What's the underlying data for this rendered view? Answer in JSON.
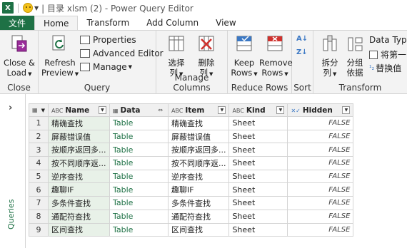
{
  "titlebar": {
    "app_letter": "X",
    "title": "| 目录 xlsm (2) - Power Query Editor"
  },
  "tabs": [
    {
      "label": "文件"
    },
    {
      "label": "Home"
    },
    {
      "label": "Transform"
    },
    {
      "label": "Add Column"
    },
    {
      "label": "View"
    }
  ],
  "ribbon": {
    "close": {
      "btn": "Close &",
      "btn2": "Load",
      "label": "Close"
    },
    "query": {
      "refresh": "Refresh",
      "refresh2": "Preview",
      "properties": "Properties",
      "advanced": "Advanced Editor",
      "manage": "Manage",
      "label": "Query"
    },
    "manage_cols": {
      "choose": "选择",
      "choose2": "列",
      "remove": "删除",
      "remove2": "列",
      "label": "Manage Columns"
    },
    "reduce": {
      "keep": "Keep",
      "keep2": "Rows",
      "remove": "Remove",
      "remove2": "Rows",
      "label": "Reduce Rows"
    },
    "sort": {
      "az": "A↓",
      "za": "Z↓",
      "label": "Sort"
    },
    "transform": {
      "split": "拆分",
      "split2": "列",
      "group": "分组",
      "group2": "依据",
      "datatype": "Data Type",
      "firstrow": "将第一",
      "replace": "替换值",
      "label": "Transform"
    }
  },
  "queries_pane": {
    "label": "Queries"
  },
  "table": {
    "columns": [
      "Name",
      "Data",
      "Item",
      "Kind",
      "Hidden"
    ],
    "rows": [
      [
        "精确查找",
        "Table",
        "精确查找",
        "Sheet",
        "FALSE"
      ],
      [
        "屏蔽错误值",
        "Table",
        "屏蔽错误值",
        "Sheet",
        "FALSE"
      ],
      [
        "按顺序返回多...",
        "Table",
        "按顺序返回多...",
        "Sheet",
        "FALSE"
      ],
      [
        "按不同顺序返...",
        "Table",
        "按不同顺序返...",
        "Sheet",
        "FALSE"
      ],
      [
        "逆序查找",
        "Table",
        "逆序查找",
        "Sheet",
        "FALSE"
      ],
      [
        "趣聊IF",
        "Table",
        "趣聊IF",
        "Sheet",
        "FALSE"
      ],
      [
        "多条件查找",
        "Table",
        "多条件查找",
        "Sheet",
        "FALSE"
      ],
      [
        "通配符查找",
        "Table",
        "通配符查找",
        "Sheet",
        "FALSE"
      ],
      [
        "区间查找",
        "Table",
        "区间查找",
        "Sheet",
        "FALSE"
      ]
    ]
  }
}
